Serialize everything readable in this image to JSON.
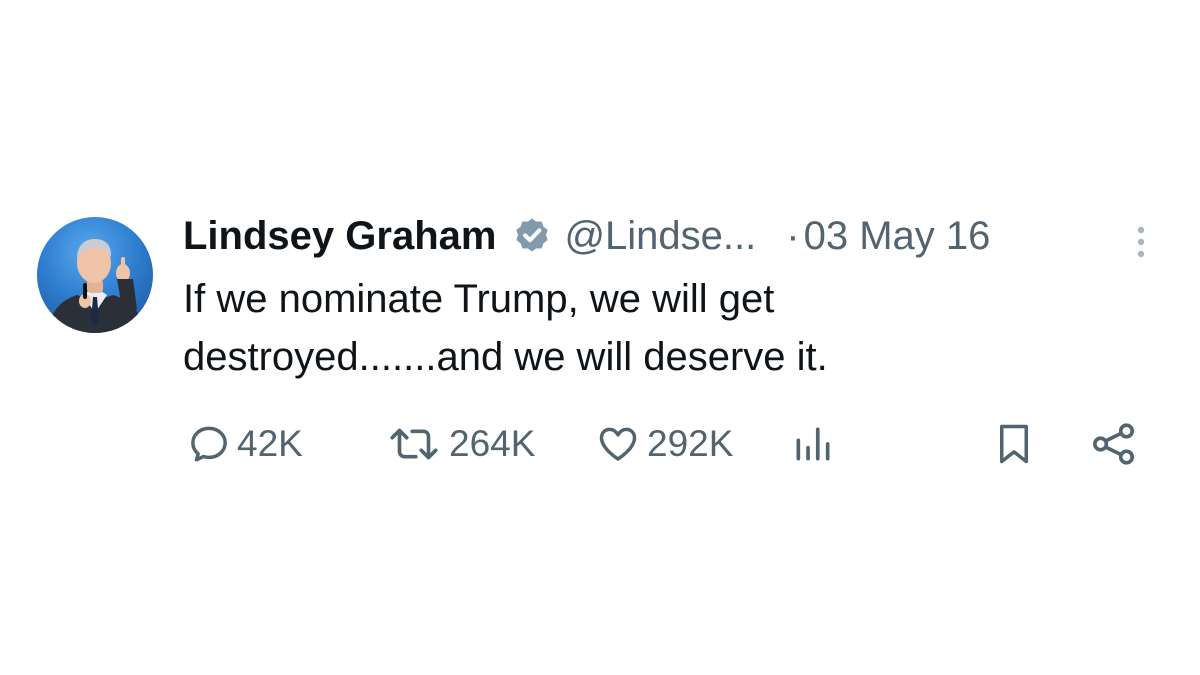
{
  "tweet": {
    "author": {
      "display_name": "Lindsey Graham",
      "verified": true,
      "handle": "@Lindse...",
      "avatar": "profile-photo"
    },
    "separator": "·",
    "date": "03 May 16",
    "text": "If we nominate Trump, we will get\ndestroyed.......and we will deserve it.",
    "stats": {
      "replies": "42K",
      "retweets": "264K",
      "likes": "292K"
    }
  },
  "icons": {
    "verified": "verified-badge-icon",
    "more": "more-vertical-icon",
    "reply": "reply-icon",
    "retweet": "retweet-icon",
    "like": "heart-icon",
    "views": "views-chart-icon",
    "bookmark": "bookmark-icon",
    "share": "share-icon"
  },
  "colors": {
    "text_primary": "#0f1419",
    "text_secondary": "#536471",
    "badge": "#829aab",
    "background": "#ffffff"
  }
}
